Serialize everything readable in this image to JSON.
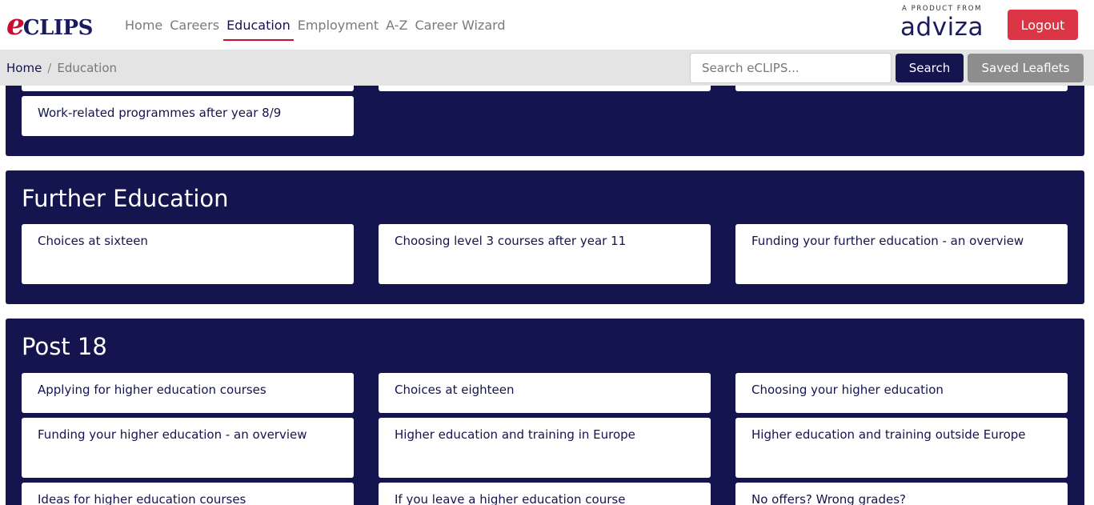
{
  "header": {
    "logo_mark": "e",
    "logo_text": "CLIPS",
    "nav": [
      "Home",
      "Careers",
      "Education",
      "Employment",
      "A-Z",
      "Career Wizard"
    ],
    "brand_sub": "A PRODUCT FROM",
    "brand_name": "adviza",
    "logout_label": "Logout"
  },
  "breadcrumb": {
    "home": "Home",
    "separator": "/",
    "current": "Education"
  },
  "search": {
    "placeholder": "Search eCLIPS...",
    "button_label": "Search",
    "saved_label": "Saved Leaflets"
  },
  "sections": {
    "earlier": {
      "cards": [
        "Work-related programmes after year 8/9"
      ]
    },
    "further": {
      "title": "Further Education",
      "cards": [
        "Choices at sixteen",
        "Choosing level 3 courses after year 11",
        "Funding your further education - an overview"
      ]
    },
    "post18": {
      "title": "Post 18",
      "cards": [
        "Applying for higher education courses",
        "Choices at eighteen",
        "Choosing your higher education",
        "Funding your higher education - an overview",
        "Higher education and training in Europe",
        "Higher education and training outside Europe",
        "Ideas for higher education courses",
        "If you leave a higher education course",
        "No offers? Wrong grades?"
      ]
    }
  },
  "colors": {
    "navy": "#14144f",
    "red": "#dc3545",
    "grey_button": "#8d8d8d",
    "subbar": "#e4e4e4"
  }
}
